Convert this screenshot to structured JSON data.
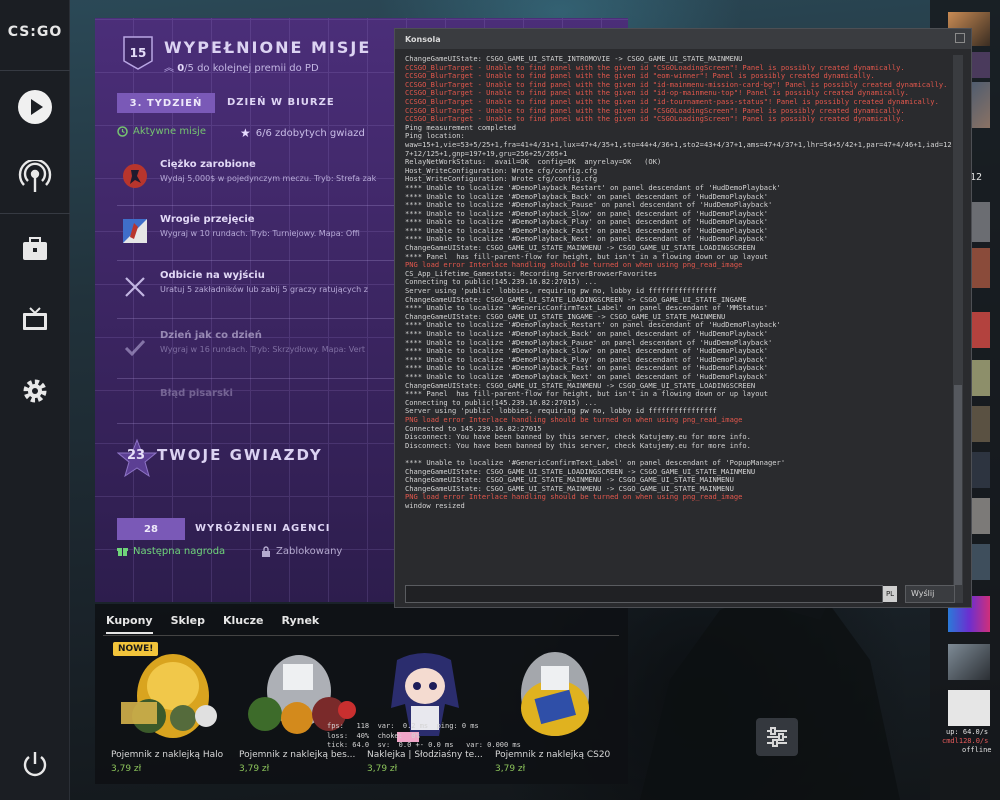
{
  "rail": {
    "logo": "CS:GO",
    "items": [
      "play-icon",
      "broadcast-icon",
      "inventory-icon",
      "watch-icon",
      "settings-icon"
    ],
    "power": "power-icon"
  },
  "missions": {
    "level_badge": "15",
    "title": "WYPEŁNIONE MISJE",
    "progress_count": "0",
    "progress_suffix": "/5 do kolejnej premii do PD",
    "week_label": "3. TYDZIEŃ",
    "week_name": "DZIEŃ W BIURZE",
    "active_label": "Aktywne misje",
    "stars_text": "6/6 zdobytych gwiazd",
    "list": [
      {
        "title": "Ciężko zarobione",
        "desc": "Wydaj 5,000$ w pojedynczym meczu. Tryb: Strefa zak"
      },
      {
        "title": "Wrogie przejęcie",
        "desc": "Wygraj w 10 rundach. Tryb: Turniejowy. Mapa: Offi"
      },
      {
        "title": "Odbicie na wyjściu",
        "desc": "Uratuj 5 zakładników lub zabij 5 graczy ratujących z"
      },
      {
        "title": "Dzień jak co dzień",
        "desc": "Wygraj w 16 rundach. Tryb: Skrzydłowy. Mapa: Vert"
      },
      {
        "title": "Błąd pisarski",
        "desc": ""
      }
    ],
    "stars_total": "23",
    "stars_title": "TWOJE GWIAZDY",
    "agents_level": "28",
    "agents_title": "WYRÓŻNIENI AGENCI",
    "next_reward": "Następna nagroda",
    "locked": "Zablokowany"
  },
  "store": {
    "tabs": [
      "Kupony",
      "Sklep",
      "Klucze",
      "Rynek"
    ],
    "new_badge": "NOWE!",
    "items": [
      {
        "name": "Pojemnik z naklejką Halo",
        "price": "3,79 zł"
      },
      {
        "name": "Pojemnik z naklejką bes...",
        "price": "3,79 zł"
      },
      {
        "name": "Naklejka | Słodziaśny te...",
        "price": "3,79 zł"
      },
      {
        "name": "Pojemnik z naklejką CS20",
        "price": "3,79 zł"
      }
    ],
    "netgraph": "fps:   118  var:  0.2 ms  ping: 0 ms\nloss:  40%  choke:  0%\ntick: 64.0  sv:  0.0 +- 0.0 ms   var: 0.000 ms"
  },
  "console": {
    "title": "Konsola",
    "lang": "PL",
    "send": "Wyślij",
    "lines": [
      {
        "t": "ChangeGameUIState: CSGO_GAME_UI_STATE_INTROMOVIE -> CSGO_GAME_UI_STATE_MAINMENU",
        "red": false
      },
      {
        "t": "CCSGO_BlurTarget - Unable to find panel with the given id \"CSGOLoadingScreen\"! Panel is possibly created dynamically.",
        "red": true
      },
      {
        "t": "CCSGO_BlurTarget - Unable to find panel with the given id \"eom-winner\"! Panel is possibly created dynamically.",
        "red": true
      },
      {
        "t": "CCSGO_BlurTarget - Unable to find panel with the given id \"id-mainmenu-mission-card-bg\"! Panel is possibly created dynamically.",
        "red": true
      },
      {
        "t": "CCSGO_BlurTarget - Unable to find panel with the given id \"id-op-mainmenu-top\"! Panel is possibly created dynamically.",
        "red": true
      },
      {
        "t": "CCSGO_BlurTarget - Unable to find panel with the given id \"id-tournament-pass-status\"! Panel is possibly created dynamically.",
        "red": true
      },
      {
        "t": "CCSGO_BlurTarget - Unable to find panel with the given id \"CSGOLoadingScreen\"! Panel is possibly created dynamically.",
        "red": true
      },
      {
        "t": "CCSGO_BlurTarget - Unable to find panel with the given id \"CSGOLoadingScreen\"! Panel is possibly created dynamically.",
        "red": true
      },
      {
        "t": "Ping measurement completed",
        "red": false
      },
      {
        "t": "Ping location:",
        "red": false
      },
      {
        "t": "waw=15+1,vie=53+5/25+1,fra=41+4/31+1,lux=47+4/35+1,sto=44+4/36+1,sto2=43+4/37+1,ams=47+4/37+1,lhr=54+5/42+1,par=47+4/46+1,iad=127+12/125+1,gnp=197+19,gru=256+25/265+1",
        "red": false
      },
      {
        "t": "RelayNetWorkStatus:  avail=OK  config=OK  anyrelay=OK   (OK)",
        "red": false
      },
      {
        "t": "Host_WriteConfiguration: Wrote cfg/config.cfg",
        "red": false
      },
      {
        "t": "Host_WriteConfiguration: Wrote cfg/config.cfg",
        "red": false
      },
      {
        "t": "**** Unable to localize '#DemoPlayback_Restart' on panel descendant of 'HudDemoPlayback'",
        "red": false
      },
      {
        "t": "**** Unable to localize '#DemoPlayback_Back' on panel descendant of 'HudDemoPlayback'",
        "red": false
      },
      {
        "t": "**** Unable to localize '#DemoPlayback_Pause' on panel descendant of 'HudDemoPlayback'",
        "red": false
      },
      {
        "t": "**** Unable to localize '#DemoPlayback_Slow' on panel descendant of 'HudDemoPlayback'",
        "red": false
      },
      {
        "t": "**** Unable to localize '#DemoPlayback_Play' on panel descendant of 'HudDemoPlayback'",
        "red": false
      },
      {
        "t": "**** Unable to localize '#DemoPlayback_Fast' on panel descendant of 'HudDemoPlayback'",
        "red": false
      },
      {
        "t": "**** Unable to localize '#DemoPlayback_Next' on panel descendant of 'HudDemoPlayback'",
        "red": false
      },
      {
        "t": "ChangeGameUIState: CSGO_GAME_UI_STATE_MAINMENU -> CSGO_GAME_UI_STATE_LOADINGSCREEN",
        "red": false
      },
      {
        "t": "**** Panel  has fill-parent-flow for height, but isn't in a flowing down or up layout",
        "red": false
      },
      {
        "t": "PNG load error Interlace handling should be turned on when using png_read_image",
        "red": true
      },
      {
        "t": "CS_App_Lifetime_Gamestats: Recording ServerBrowserFavorites",
        "red": false
      },
      {
        "t": "Connecting to public(145.239.16.82:27015) ...",
        "red": false
      },
      {
        "t": "Server using 'public' lobbies, requiring pw no, lobby id ffffffffffffffff",
        "red": false
      },
      {
        "t": "ChangeGameUIState: CSGO_GAME_UI_STATE_LOADINGSCREEN -> CSGO_GAME_UI_STATE_INGAME",
        "red": false
      },
      {
        "t": "**** Unable to localize '#GenericConfirmText_Label' on panel descendant of 'MMStatus'",
        "red": false
      },
      {
        "t": "ChangeGameUIState: CSGO_GAME_UI_STATE_INGAME -> CSGO_GAME_UI_STATE_MAINMENU",
        "red": false
      },
      {
        "t": "**** Unable to localize '#DemoPlayback_Restart' on panel descendant of 'HudDemoPlayback'",
        "red": false
      },
      {
        "t": "**** Unable to localize '#DemoPlayback_Back' on panel descendant of 'HudDemoPlayback'",
        "red": false
      },
      {
        "t": "**** Unable to localize '#DemoPlayback_Pause' on panel descendant of 'HudDemoPlayback'",
        "red": false
      },
      {
        "t": "**** Unable to localize '#DemoPlayback_Slow' on panel descendant of 'HudDemoPlayback'",
        "red": false
      },
      {
        "t": "**** Unable to localize '#DemoPlayback_Play' on panel descendant of 'HudDemoPlayback'",
        "red": false
      },
      {
        "t": "**** Unable to localize '#DemoPlayback_Fast' on panel descendant of 'HudDemoPlayback'",
        "red": false
      },
      {
        "t": "**** Unable to localize '#DemoPlayback_Next' on panel descendant of 'HudDemoPlayback'",
        "red": false
      },
      {
        "t": "ChangeGameUIState: CSGO_GAME_UI_STATE_MAINMENU -> CSGO_GAME_UI_STATE_LOADINGSCREEN",
        "red": false
      },
      {
        "t": "**** Panel  has fill-parent-flow for height, but isn't in a flowing down or up layout",
        "red": false
      },
      {
        "t": "Connecting to public(145.239.16.82:27015) ...",
        "red": false
      },
      {
        "t": "Server using 'public' lobbies, requiring pw no, lobby id ffffffffffffffff",
        "red": false
      },
      {
        "t": "PNG load error Interlace handling should be turned on when using png_read_image",
        "red": true
      },
      {
        "t": "Connected to 145.239.16.82:27015",
        "red": false
      },
      {
        "t": "Disconnect: You have been banned by this server, check Katujemy.eu for more info.",
        "red": false
      },
      {
        "t": "Disconnect: You have been banned by this server, check Katujemy.eu for more info.",
        "red": false
      },
      {
        "t": " ",
        "red": false
      },
      {
        "t": "**** Unable to localize '#GenericConfirmText_Label' on panel descendant of 'PopupManager'",
        "red": false
      },
      {
        "t": "ChangeGameUIState: CSGO_GAME_UI_STATE_LOADINGSCREEN -> CSGO_GAME_UI_STATE_MAINMENU",
        "red": false
      },
      {
        "t": "ChangeGameUIState: CSGO_GAME_UI_STATE_MAINMENU -> CSGO_GAME_UI_STATE_MAINMENU",
        "red": false
      },
      {
        "t": "ChangeGameUIState: CSGO_GAME_UI_STATE_MAINMENU -> CSGO_GAME_UI_STATE_MAINMENU",
        "red": false
      },
      {
        "t": "PNG load error Interlace handling should be turned on when using png_read_image",
        "red": true
      },
      {
        "t": "window resized",
        "red": false
      }
    ]
  },
  "friends": {
    "count_label": "12",
    "upload_stat": "up: 64.0/s",
    "cmd_stat": "cmdl128.0/s",
    "status": "offline"
  }
}
